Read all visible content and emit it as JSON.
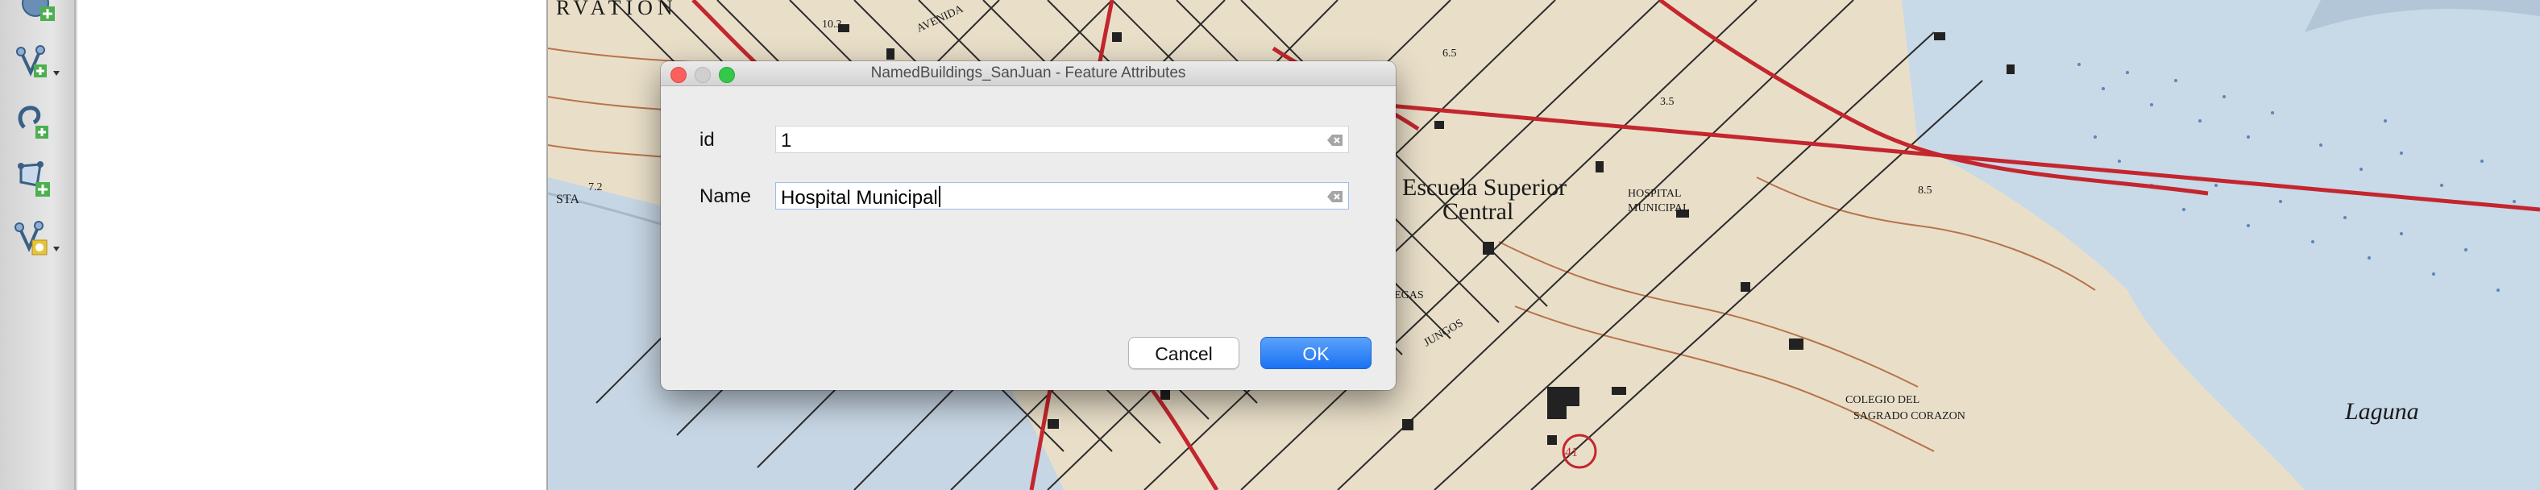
{
  "dialog": {
    "title": "NamedBuildings_SanJuan - Feature Attributes",
    "fields": [
      {
        "label": "id",
        "value": "1"
      },
      {
        "label": "Name",
        "value": "Hospital Municipal"
      }
    ],
    "cancel_label": "Cancel",
    "ok_label": "OK"
  },
  "toolbar": {
    "icons": [
      "add-feature-icon",
      "vertex-tool-dropdown-icon",
      "add-ring-icon",
      "add-part-icon",
      "node-tool-dropdown-icon"
    ]
  },
  "map": {
    "labels": [
      "RVATION",
      "Escuela Superior",
      "Central",
      "HOSPITAL",
      "MUNICIPAL",
      "COLEGIO DEL",
      "SAGRADO CORAZON",
      "Laguna",
      "AVENIDA",
      "41",
      "10.3",
      "7.2",
      "STA",
      "JUNGOS",
      "VEGAS",
      "6.5",
      "3.5",
      "8.5"
    ]
  },
  "colors": {
    "accent_button": "#1a72f3",
    "road_red": "#c4262e",
    "water": "#b9cfe2",
    "contour": "#b8734c"
  }
}
